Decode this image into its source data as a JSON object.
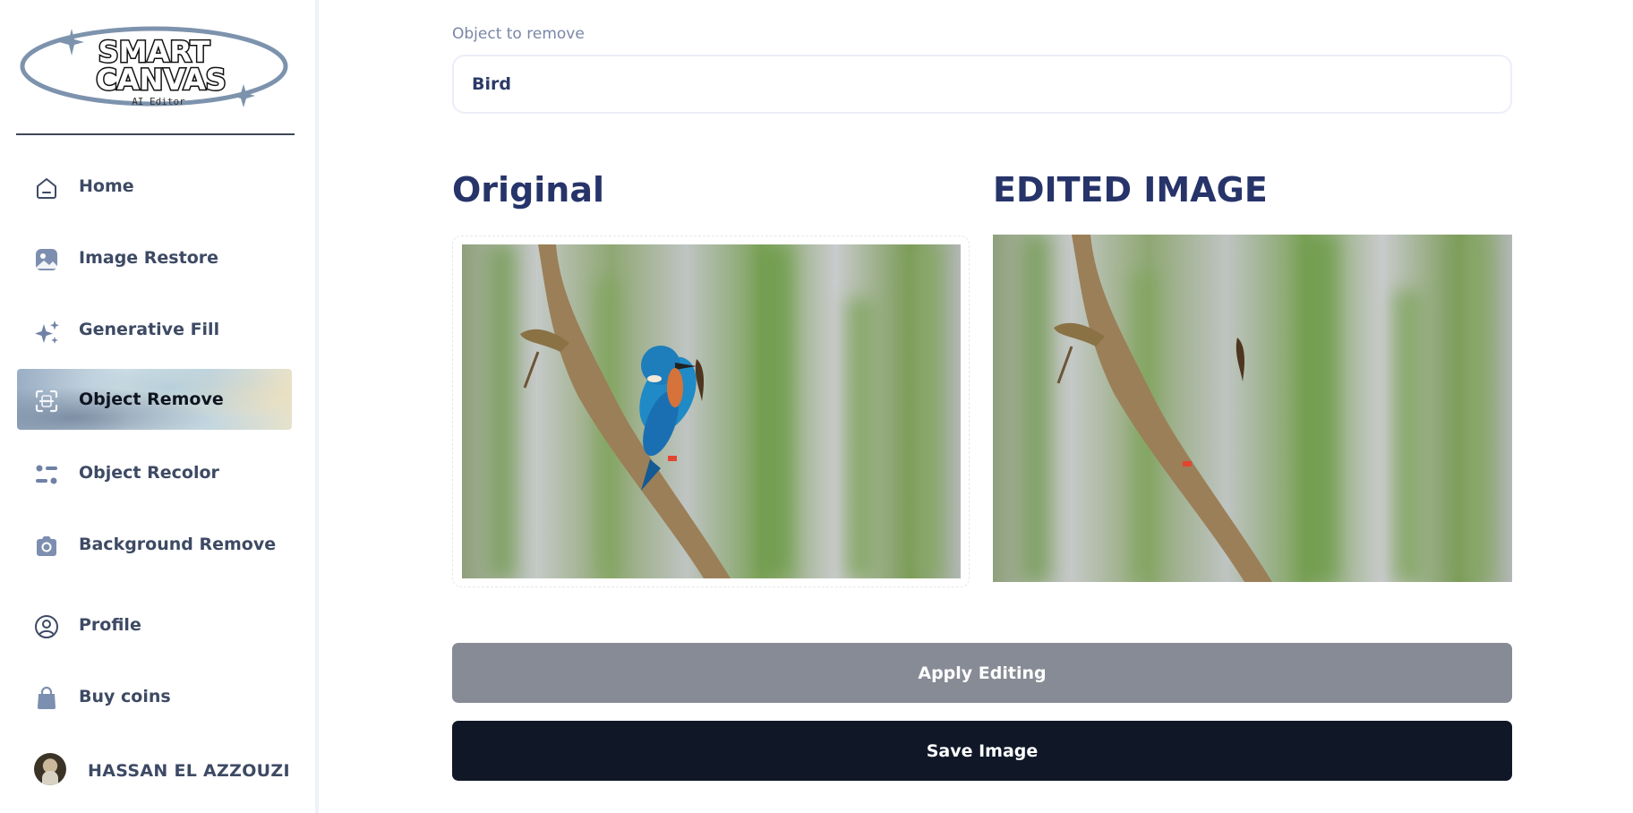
{
  "app": {
    "logo_line1": "SMART",
    "logo_line2": "CANVAS",
    "logo_tagline": "AI Editor"
  },
  "sidebar": {
    "items": [
      {
        "label": "Home",
        "icon": "home-icon"
      },
      {
        "label": "Image Restore",
        "icon": "image-icon"
      },
      {
        "label": "Generative Fill",
        "icon": "sparkles-icon"
      },
      {
        "label": "Object Remove",
        "icon": "scan-icon",
        "active": true
      },
      {
        "label": "Object Recolor",
        "icon": "sliders-icon"
      },
      {
        "label": "Background Remove",
        "icon": "camera-icon"
      },
      {
        "label": "Profile",
        "icon": "user-circle-icon"
      },
      {
        "label": "Buy coins",
        "icon": "shopping-bag-icon"
      }
    ],
    "user": {
      "name": "HASSAN EL AZZOUZI",
      "icon": "avatar"
    }
  },
  "main": {
    "object_field": {
      "label": "Object to remove",
      "value": "Bird"
    },
    "original_title": "Original",
    "edited_title": "EDITED IMAGE",
    "apply_label": "Apply Editing",
    "save_label": "Save Image"
  },
  "colors": {
    "accent_title": "#27346a",
    "apply_button": "#878b95",
    "save_button": "#101828"
  }
}
